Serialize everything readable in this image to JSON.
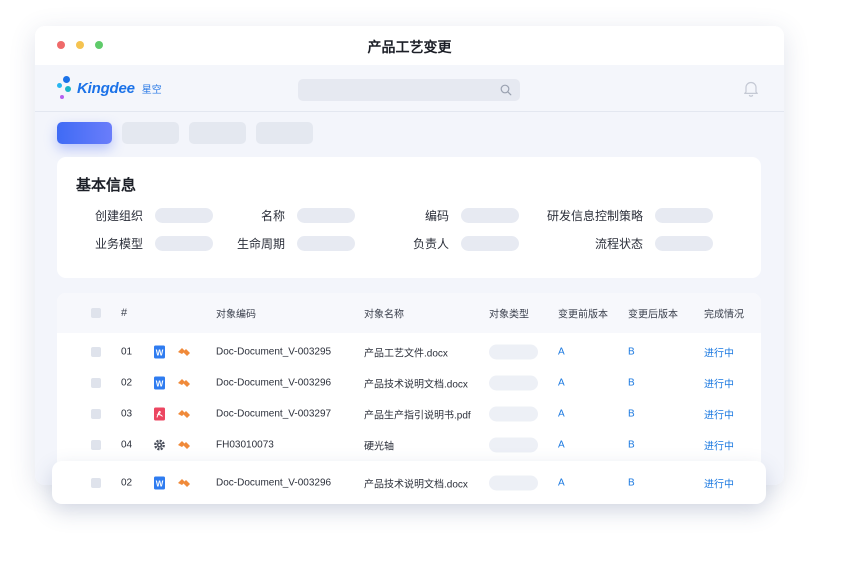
{
  "window": {
    "title": "产品工艺变更",
    "traffic_light_colors": [
      "#ef6a6a",
      "#f5c350",
      "#5fcb6a"
    ]
  },
  "header": {
    "brand_name": "Kingdee",
    "brand_sub": "星空",
    "brand_color": "#1b72e8",
    "search_icon": "search-icon",
    "bell_icon": "bell-icon"
  },
  "toolbar": {
    "tab_count": 4,
    "active_tab_color": "#4a6cf7"
  },
  "basic_info": {
    "title": "基本信息",
    "fields": [
      {
        "label": "创建组织"
      },
      {
        "label": "名称"
      },
      {
        "label": "编码"
      },
      {
        "label": "研发信息控制策略"
      },
      {
        "label": "业务模型"
      },
      {
        "label": "生命周期"
      },
      {
        "label": "负责人"
      },
      {
        "label": "流程状态"
      }
    ]
  },
  "table": {
    "columns": {
      "index": "#",
      "code": "对象编码",
      "name": "对象名称",
      "type": "对象类型",
      "before": "变更前版本",
      "after": "变更后版本",
      "status": "完成情况"
    },
    "rows": [
      {
        "index": "01",
        "icon": "word-doc-icon",
        "code": "Doc-Document_V-003295",
        "name": "产品工艺文件.docx",
        "before": "A",
        "after": "B",
        "status": "进行中"
      },
      {
        "index": "02",
        "icon": "word-doc-icon",
        "code": "Doc-Document_V-003296",
        "name": "产品技术说明文档.docx",
        "before": "A",
        "after": "B",
        "status": "进行中"
      },
      {
        "index": "03",
        "icon": "pdf-doc-icon",
        "code": "Doc-Document_V-003297",
        "name": "产品生产指引说明书.pdf",
        "before": "A",
        "after": "B",
        "status": "进行中"
      },
      {
        "index": "04",
        "icon": "gear-icon",
        "code": "FH03010073",
        "name": "硬光轴",
        "before": "A",
        "after": "B",
        "status": "进行中"
      }
    ],
    "floating_row": {
      "index": "02",
      "icon": "word-doc-icon",
      "code": "Doc-Document_V-003296",
      "name": "产品技术说明文档.docx",
      "before": "A",
      "after": "B",
      "status": "进行中"
    }
  }
}
